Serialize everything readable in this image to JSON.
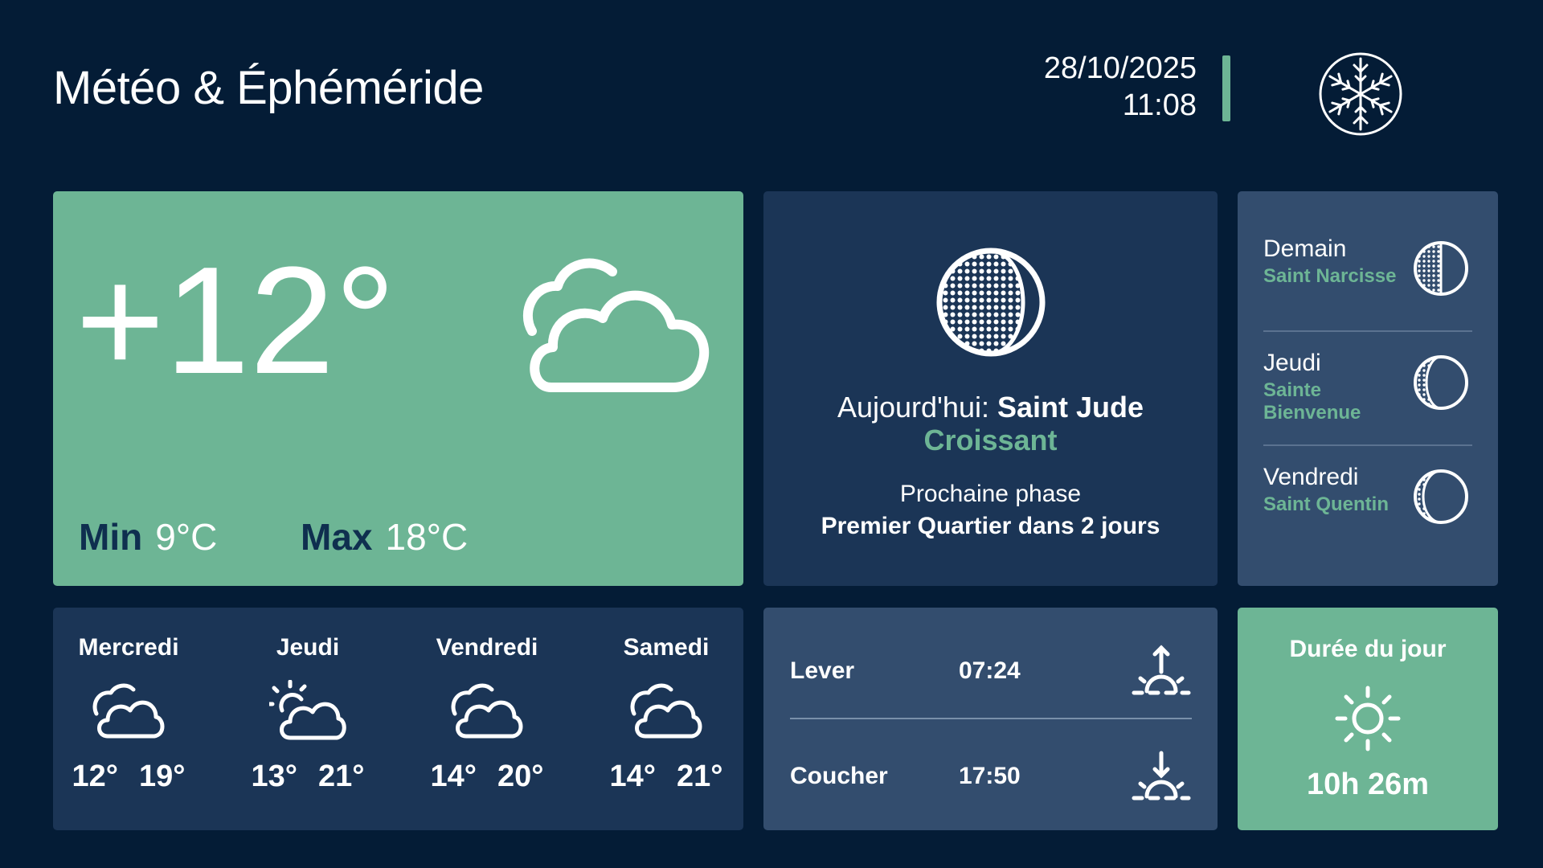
{
  "header": {
    "title": "Météo & Éphéméride",
    "date": "28/10/2025",
    "time": "11:08",
    "logo_icon": "snowflake-icon"
  },
  "current": {
    "temperature": "+12°",
    "icon": "partly-cloudy-icon",
    "min_label": "Min",
    "min_value": "9°C",
    "max_label": "Max",
    "max_value": "18°C"
  },
  "moon_today": {
    "prefix": "Aujourd'hui: ",
    "saint": "Saint Jude",
    "phase": "Croissant",
    "next_phase_label": "Prochaine phase",
    "next_phase_value": "Premier Quartier dans 2 jours",
    "icon": "moon-phase-icon"
  },
  "moon_next": [
    {
      "day": "Demain",
      "saint": "Saint Narcisse",
      "icon": "moon-phase-icon"
    },
    {
      "day": "Jeudi",
      "saint": "Sainte Bienvenue",
      "icon": "moon-phase-icon"
    },
    {
      "day": "Vendredi",
      "saint": "Saint Quentin",
      "icon": "moon-phase-icon"
    }
  ],
  "forecast": [
    {
      "day": "Mercredi",
      "icon": "cloudy-icon",
      "min": "12°",
      "max": "19°"
    },
    {
      "day": "Jeudi",
      "icon": "sun-cloud-icon",
      "min": "13°",
      "max": "21°"
    },
    {
      "day": "Vendredi",
      "icon": "cloudy-icon",
      "min": "14°",
      "max": "20°"
    },
    {
      "day": "Samedi",
      "icon": "cloudy-icon",
      "min": "14°",
      "max": "21°"
    }
  ],
  "sun": {
    "sunrise_label": "Lever",
    "sunrise_time": "07:24",
    "sunset_label": "Coucher",
    "sunset_time": "17:50"
  },
  "day_length": {
    "label": "Durée du jour",
    "value": "10h 26m",
    "icon": "sun-icon"
  },
  "colors": {
    "background": "#041c36",
    "card_navy": "#1b3556",
    "card_mid": "#334d6e",
    "accent_green": "#6db595"
  }
}
